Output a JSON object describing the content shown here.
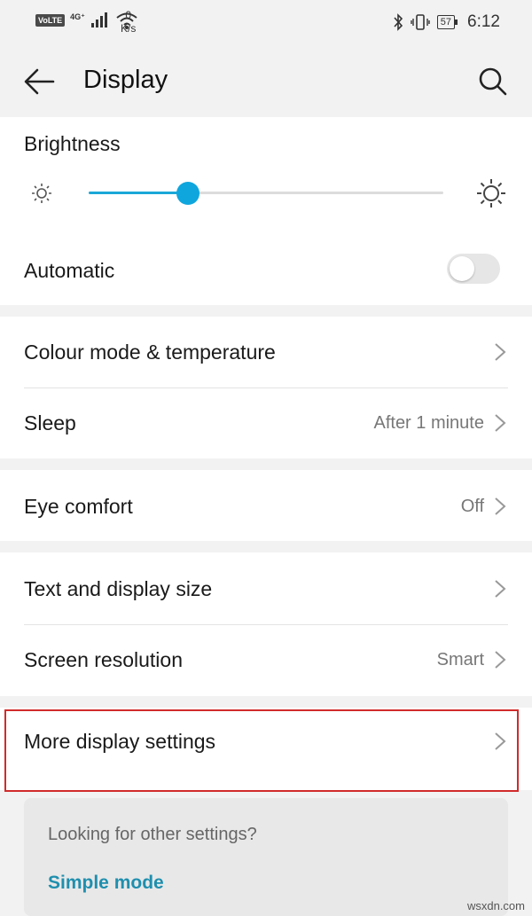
{
  "status_bar": {
    "volte": "VoLTE",
    "network": "4G⁺",
    "speed_value": "0",
    "speed_unit": "K/s",
    "battery": "57",
    "time": "6:12"
  },
  "header": {
    "title": "Display"
  },
  "brightness": {
    "label": "Brightness",
    "level": 0.28
  },
  "automatic": {
    "label": "Automatic",
    "enabled": false
  },
  "colour_mode": {
    "label": "Colour mode & temperature"
  },
  "sleep": {
    "label": "Sleep",
    "value": "After 1 minute"
  },
  "eye_comfort": {
    "label": "Eye comfort",
    "value": "Off"
  },
  "text_size": {
    "label": "Text and display size"
  },
  "screen_resolution": {
    "label": "Screen resolution",
    "value": "Smart"
  },
  "more_display": {
    "label": "More display settings"
  },
  "suggestion": {
    "question": "Looking for other settings?",
    "link": "Simple mode"
  },
  "watermark": "wsxdn.com",
  "colors": {
    "accent": "#0fa6de",
    "highlight_border": "#d12b2b",
    "link": "#1f8fae"
  }
}
